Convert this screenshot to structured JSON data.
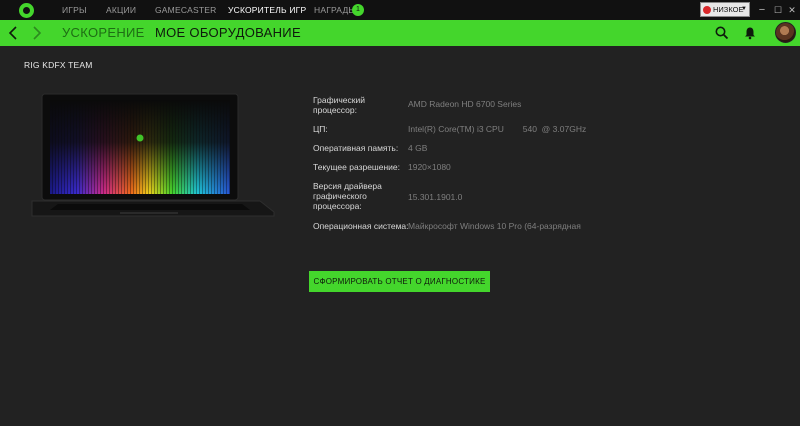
{
  "nav": {
    "items": [
      {
        "label": "ИГРЫ"
      },
      {
        "label": "АКЦИИ"
      },
      {
        "label": "GAMECASTER"
      },
      {
        "label": "УСКОРИТЕЛЬ ИГР"
      },
      {
        "label": "НАГРАДЫ"
      }
    ],
    "rewards_badge": "1",
    "active_index": 3
  },
  "performance_mode": {
    "label": "НИЗКОЕ",
    "indicator_color": "#d8272a"
  },
  "window_controls": {
    "minimize": "−",
    "maximize": "☐",
    "close": "✕"
  },
  "header": {
    "tabs": [
      {
        "label": "УСКОРЕНИЕ"
      },
      {
        "label": "МОЕ ОБОРУДОВАНИЕ"
      }
    ],
    "active_tab_index": 1,
    "icons": [
      "back-arrow-icon",
      "forward-arrow-icon",
      "search-icon",
      "bell-icon",
      "avatar"
    ]
  },
  "rig": {
    "name": "RIG KDFX TEAM"
  },
  "specs": [
    {
      "label": "Графический процессор:",
      "value": "AMD Radeon HD 6700 Series"
    },
    {
      "label": "ЦП:",
      "value": "Intel(R) Core(TM) i3 CPU        540  @ 3.07GHz"
    },
    {
      "label": "Оперативная память:",
      "value": "4 GB"
    },
    {
      "label": "Текущее разрешение:",
      "value": "1920×1080"
    },
    {
      "label": "Версия драйвера графического процессора:",
      "value": "15.301.1901.0"
    },
    {
      "label": "Операционная система:",
      "value": "Майкрософт Windows 10 Pro (64-разрядная"
    }
  ],
  "diagnostics_button": {
    "label": "СФОРМИРОВАТЬ ОТЧЕТ О ДИАГНОСТИКЕ"
  },
  "colors": {
    "accent": "#44d62c",
    "background": "#222222",
    "topbar": "#111111"
  }
}
